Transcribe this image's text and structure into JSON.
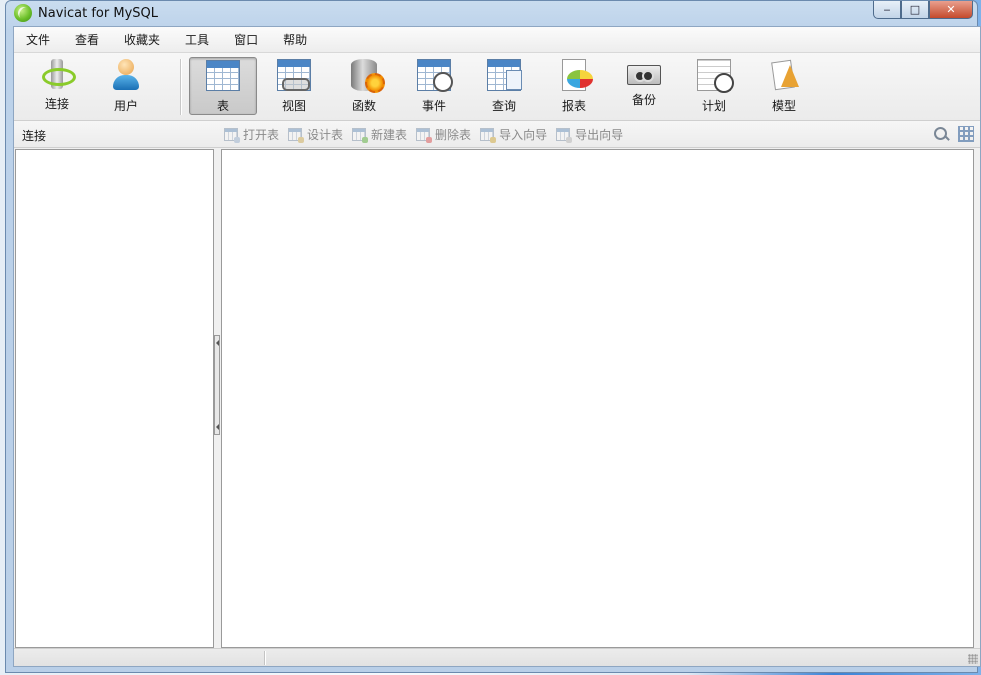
{
  "window": {
    "title": "Navicat for MySQL",
    "controls": {
      "minimize": "‒",
      "maximize": "□",
      "close": "✕"
    }
  },
  "menu": [
    "文件",
    "查看",
    "收藏夹",
    "工具",
    "窗口",
    "帮助"
  ],
  "toolbar": {
    "items": [
      {
        "label": "连接",
        "icon": "connection-icon",
        "active": false
      },
      {
        "label": "用户",
        "icon": "user-icon",
        "active": false
      },
      {
        "label": "表",
        "icon": "table-icon",
        "active": true
      },
      {
        "label": "视图",
        "icon": "view-icon",
        "active": false
      },
      {
        "label": "函数",
        "icon": "function-icon",
        "active": false
      },
      {
        "label": "事件",
        "icon": "event-icon",
        "active": false
      },
      {
        "label": "查询",
        "icon": "query-icon",
        "active": false
      },
      {
        "label": "报表",
        "icon": "report-icon",
        "active": false
      },
      {
        "label": "备份",
        "icon": "backup-icon",
        "active": false
      },
      {
        "label": "计划",
        "icon": "schedule-icon",
        "active": false
      },
      {
        "label": "模型",
        "icon": "model-icon",
        "active": false
      }
    ]
  },
  "subbar": {
    "title": "连接",
    "actions": [
      {
        "label": "打开表",
        "icon": "open-table-icon",
        "enabled": false
      },
      {
        "label": "设计表",
        "icon": "design-table-icon",
        "enabled": false
      },
      {
        "label": "新建表",
        "icon": "new-table-icon",
        "enabled": false
      },
      {
        "label": "删除表",
        "icon": "delete-table-icon",
        "enabled": false
      },
      {
        "label": "导入向导",
        "icon": "import-wizard-icon",
        "enabled": false
      },
      {
        "label": "导出向导",
        "icon": "export-wizard-icon",
        "enabled": false
      }
    ],
    "right_icons": [
      "search-icon",
      "grid-view-icon"
    ]
  },
  "colors": {
    "active_tool_bg": "#c9c9c9",
    "disabled_text": "#8a8a8a",
    "frame": "#b9cfe8"
  }
}
